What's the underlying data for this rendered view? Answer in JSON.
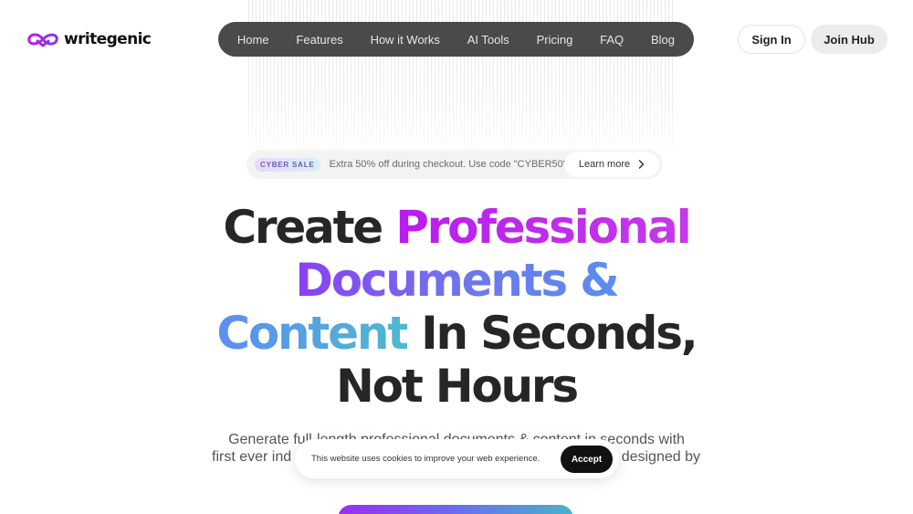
{
  "brand": {
    "name": "writegenic",
    "logo_icon": "infinity-heart-icon",
    "accent_color": "#c026f0"
  },
  "nav": {
    "items": [
      {
        "label": "Home"
      },
      {
        "label": "Features"
      },
      {
        "label": "How it Works"
      },
      {
        "label": "AI Tools"
      },
      {
        "label": "Pricing"
      },
      {
        "label": "FAQ"
      },
      {
        "label": "Blog"
      }
    ]
  },
  "auth": {
    "sign_in": "Sign In",
    "join": "Join Hub"
  },
  "promo": {
    "badge": "CYBER SALE",
    "text": "Extra 50% off during checkout. Use code \"CYBER50\"",
    "link": "Learn more",
    "link_icon": "chevron-right-icon"
  },
  "hero": {
    "line1_a": "Create ",
    "line1_b": "Professional",
    "line2": "Documents &",
    "line3_a": "Content",
    "line3_b": " In Seconds,",
    "line4": "Not Hours",
    "gradient_colors": [
      "#b91cf0",
      "#6f74ec",
      "#4fb8cf"
    ]
  },
  "subtitle": {
    "line1": "Generate full-length professional documents & content in seconds with",
    "line2_a": "first ever ind",
    "line2_b": "designed by"
  },
  "cookie": {
    "text": "This website uses cookies to improve your web experience.",
    "accept": "Accept"
  }
}
